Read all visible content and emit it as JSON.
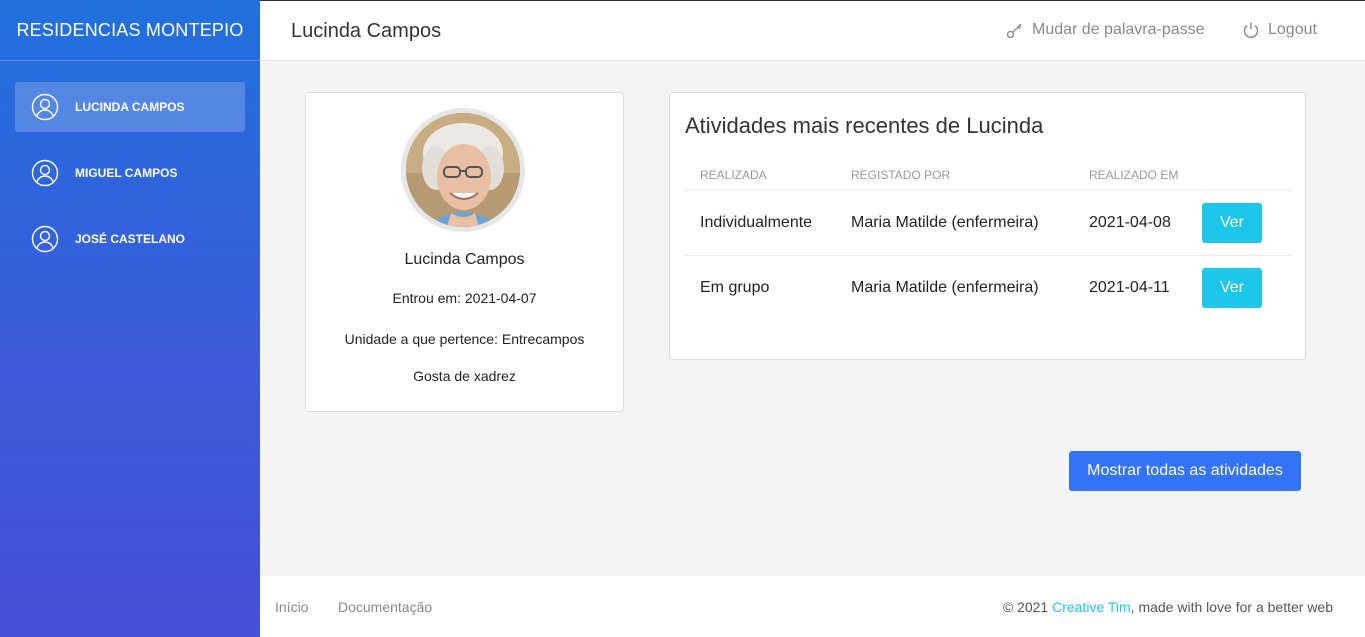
{
  "sidebar": {
    "brand": "RESIDENCIAS MONTEPIO",
    "items": [
      {
        "label": "LUCINDA CAMPOS",
        "icon": "user-circle-icon",
        "active": true
      },
      {
        "label": "MIGUEL CAMPOS",
        "icon": "user-circle-icon"
      },
      {
        "label": "JOSÉ CASTELANO",
        "icon": "user-circle-icon"
      }
    ]
  },
  "topbar": {
    "title": "Lucinda Campos",
    "change_password": "Mudar de palavra-passe",
    "logout": "Logout"
  },
  "profile": {
    "name": "Lucinda Campos",
    "joined": "Entrou em: 2021-04-07",
    "unit": "Unidade a que pertence: Entrecampos",
    "note": "Gosta de xadrez"
  },
  "activities": {
    "title": "Atividades mais recentes de Lucinda",
    "headers": [
      "REALIZADA",
      "REGISTADO POR",
      "REALIZADO EM"
    ],
    "rows": [
      {
        "realizada": "Individualmente",
        "registado_por": "Maria Matilde (enfermeira)",
        "realizado_em": "2021-04-08",
        "action": "Ver"
      },
      {
        "realizada": "Em grupo",
        "registado_por": "Maria Matilde (enfermeira)",
        "realizado_em": "2021-04-11",
        "action": "Ver"
      }
    ],
    "show_all": "Mostrar todas as atividades"
  },
  "footer": {
    "links": [
      "Início",
      "Documentação"
    ],
    "copyright_prefix": "© 2021 ",
    "copyright_link": "Creative Tim",
    "copyright_suffix": ", made with love for a better web"
  },
  "colors": {
    "sidebar_top": "#2170de",
    "sidebar_bottom": "#4550d8",
    "info": "#1dc7ea",
    "primary": "#3472f7"
  }
}
